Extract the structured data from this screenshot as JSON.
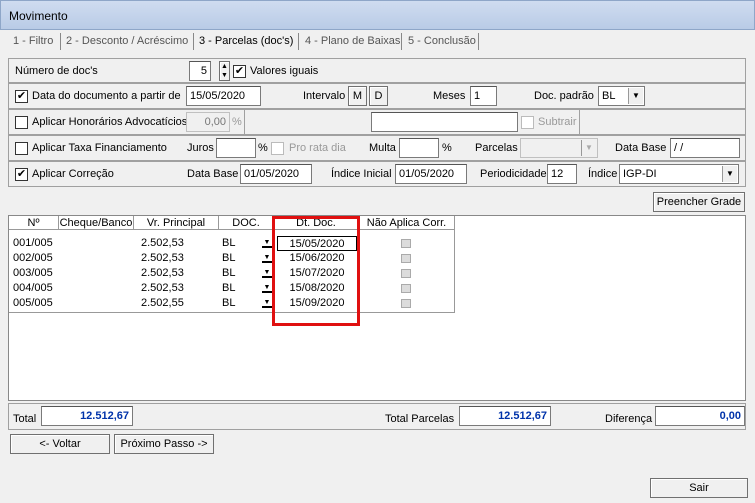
{
  "window": {
    "title": "Movimento"
  },
  "tabs": [
    {
      "label": "1 - Filtro"
    },
    {
      "label": "2 - Desconto / Acréscimo"
    },
    {
      "label": "3 - Parcelas (doc's)"
    },
    {
      "label": "4 - Plano de Baixas"
    },
    {
      "label": "5 - Conclusão"
    }
  ],
  "docs": {
    "label": "Número de doc's",
    "value": "5",
    "valores_iguais": "Valores iguais"
  },
  "data_doc": {
    "label": "Data do documento a partir de",
    "value": "15/05/2020",
    "intervalo": "Intervalo",
    "m": "M",
    "d": "D",
    "meses": "Meses",
    "meses_value": "1",
    "doc_padrao": "Doc. padrão",
    "doc_padrao_value": "BL"
  },
  "honorarios": {
    "label": "Aplicar Honorários Advocatícios",
    "value": "0,00",
    "pct": "%",
    "subtrair": "Subtrair"
  },
  "taxa": {
    "label": "Aplicar Taxa Financiamento",
    "juros": "Juros",
    "pct": "%",
    "pro_rata": "Pro rata dia",
    "multa": "Multa",
    "parcelas": "Parcelas",
    "data_base": "Data Base",
    "data_base_value": " / /"
  },
  "correcao": {
    "label": "Aplicar Correção",
    "data_base": "Data Base",
    "data_base_value": "01/05/2020",
    "indice_inicial": "Índice Inicial",
    "indice_inicial_value": "01/05/2020",
    "periodicidade": "Periodicidade",
    "periodicidade_value": "12",
    "indice": "Índice",
    "indice_value": "IGP-DI"
  },
  "preencher": "Preencher Grade",
  "grid": {
    "headers": [
      "Nº",
      "Cheque/Banco",
      "Vr. Principal",
      "DOC.",
      "Dt. Doc.",
      "Não Aplica Corr."
    ],
    "rows": [
      {
        "n": "001/005",
        "banco": "",
        "valor": "2.502,53",
        "doc": "BL",
        "data": "15/05/2020"
      },
      {
        "n": "002/005",
        "banco": "",
        "valor": "2.502,53",
        "doc": "BL",
        "data": "15/06/2020"
      },
      {
        "n": "003/005",
        "banco": "",
        "valor": "2.502,53",
        "doc": "BL",
        "data": "15/07/2020"
      },
      {
        "n": "004/005",
        "banco": "",
        "valor": "2.502,53",
        "doc": "BL",
        "data": "15/08/2020"
      },
      {
        "n": "005/005",
        "banco": "",
        "valor": "2.502,55",
        "doc": "BL",
        "data": "15/09/2020"
      }
    ]
  },
  "totals": {
    "total_label": "Total",
    "total_value": "12.512,67",
    "parcelas_label": "Total Parcelas",
    "parcelas_value": "12.512,67",
    "diferenca_label": "Diferença",
    "diferenca_value": "0,00"
  },
  "buttons": {
    "voltar": "<- Voltar",
    "proximo": "Próximo Passo ->",
    "sair": "Sair"
  },
  "colors": {
    "highlight": "#e01010",
    "total_text": "#0033aa"
  }
}
